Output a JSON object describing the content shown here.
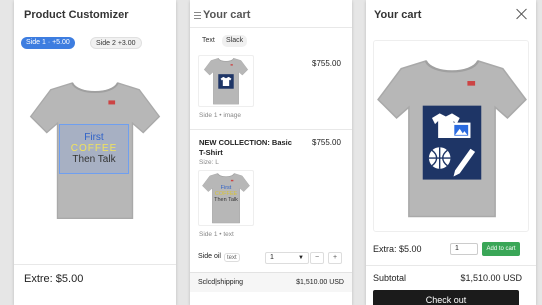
{
  "customizer": {
    "title": "Product Customizer",
    "side_tabs": [
      {
        "label": "Side 1",
        "price": "+5.00"
      },
      {
        "label": "Side 2",
        "price": "+3.00"
      }
    ],
    "print_text": [
      "First",
      "COFFEE",
      "Then Talk"
    ],
    "extra": "Extre: $5.00"
  },
  "cart_panel": {
    "title": "Your cart",
    "chips": [
      "Text",
      "Slack"
    ],
    "items": [
      {
        "price": "$755.00",
        "caption": "Side 1 • image"
      },
      {
        "name": "NEW COLLECTION:  Basic T-Shirt",
        "size": "Size: L",
        "price": "$755.00",
        "print_text": [
          "First",
          "COFFEE",
          "Then Talk"
        ],
        "caption": "Side 1 • text"
      }
    ],
    "side_label": "Side oil",
    "side_chip": "text",
    "qty": "1",
    "stepper_minus": "−",
    "stepper_plus": "+",
    "summary_label": "Sclcd|shipping",
    "summary_value": "$1,510.00 USD"
  },
  "cart_modal": {
    "title": "Your cart",
    "extra": "Extra: $5.00",
    "qty": "1",
    "add_label": "Add to cart",
    "subtotal_label": "Subtotal",
    "subtotal_value": "$1,510.00 USD",
    "checkout_label": "Check out"
  },
  "colors": {
    "accent": "#3d7de0",
    "add_button": "#3aa657",
    "checkout": "#1b1b1b",
    "shirt": "#b7b7b7",
    "design_bg": "#1e3566"
  },
  "icons": [
    "close-icon",
    "menu-icon",
    "chevron-down-icon",
    "tshirt-icon",
    "image-icon",
    "basketball-icon",
    "pen-icon",
    "brush-icon"
  ]
}
